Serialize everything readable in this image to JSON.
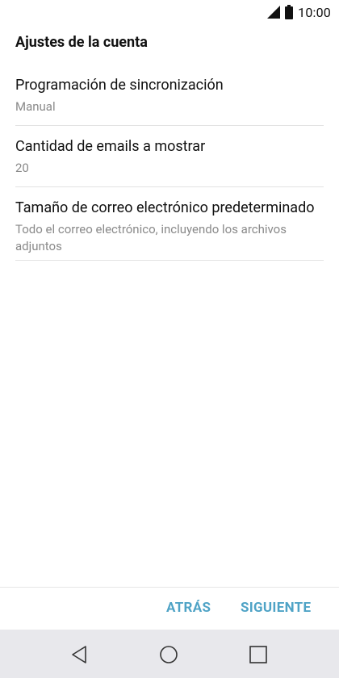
{
  "status_bar": {
    "time": "10:00",
    "icons": [
      "signal-icon",
      "battery-icon"
    ]
  },
  "header": {
    "title": "Ajustes de la cuenta"
  },
  "settings": [
    {
      "title": "Programación de sincronización",
      "value": "Manual"
    },
    {
      "title": "Cantidad de emails a mostrar",
      "value": "20"
    },
    {
      "title": "Tamaño de correo electrónico predeterminado",
      "value": "Todo el correo electrónico, incluyendo los archivos adjuntos"
    }
  ],
  "actions": {
    "back_label": "ATRÁS",
    "next_label": "SIGUIENTE",
    "accent_color": "#4fa3c6"
  },
  "nav_bar": {
    "icons": [
      "back-icon",
      "home-icon",
      "recents-icon"
    ]
  }
}
